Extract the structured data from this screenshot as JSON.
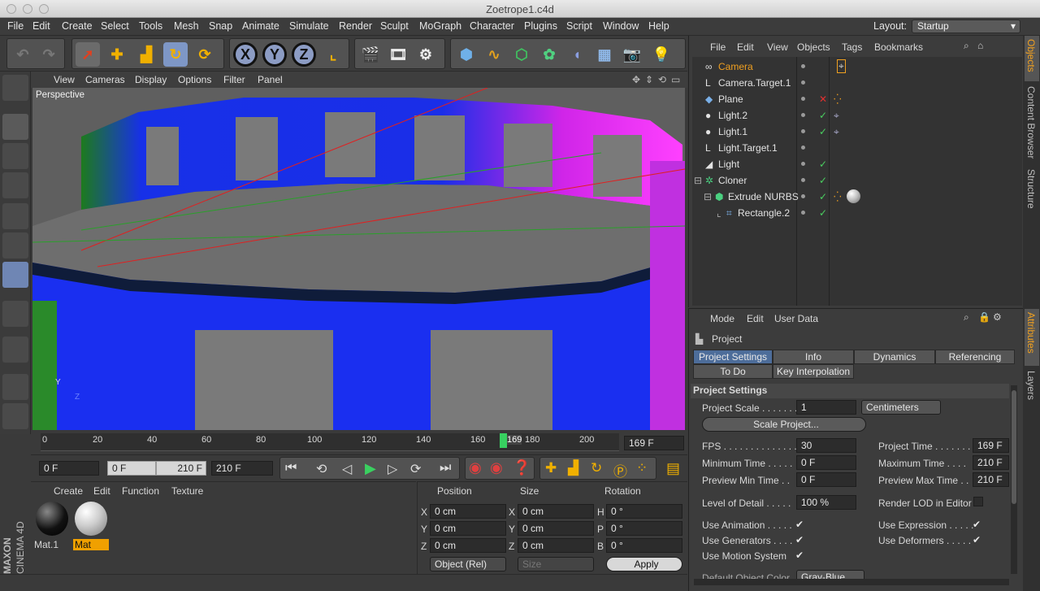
{
  "window": {
    "title": "Zoetrope1.c4d"
  },
  "menu": [
    "File",
    "Edit",
    "Create",
    "Select",
    "Tools",
    "Mesh",
    "Snap",
    "Animate",
    "Simulate",
    "Render",
    "Sculpt",
    "MoGraph",
    "Character",
    "Plugins",
    "Script",
    "Window",
    "Help"
  ],
  "layout": {
    "label": "Layout:",
    "value": "Startup"
  },
  "toolbar": {
    "x": "X",
    "y": "Y",
    "z": "Z"
  },
  "viewport": {
    "menu": [
      "View",
      "Cameras",
      "Display",
      "Options",
      "Filter",
      "Panel"
    ],
    "label": "Perspective"
  },
  "timeline": {
    "ticks": [
      "0",
      "20",
      "40",
      "60",
      "80",
      "100",
      "120",
      "140",
      "160",
      "180",
      "200"
    ],
    "current_frame": "169",
    "frame_field": "169 F"
  },
  "playback": {
    "start": "0 F",
    "range_start": "0 F",
    "range_end": "210 F",
    "end": "210 F"
  },
  "materials": {
    "menu": [
      "Create",
      "Edit",
      "Function",
      "Texture"
    ],
    "items": [
      {
        "name": "Mat.1"
      },
      {
        "name": "Mat"
      }
    ]
  },
  "coords": {
    "headers": [
      "Position",
      "Size",
      "Rotation"
    ],
    "rows": [
      {
        "axis": "X",
        "pos": "0 cm",
        "saxis": "X",
        "size": "0 cm",
        "raxis": "H",
        "rot": "0 °"
      },
      {
        "axis": "Y",
        "pos": "0 cm",
        "saxis": "Y",
        "size": "0 cm",
        "raxis": "P",
        "rot": "0 °"
      },
      {
        "axis": "Z",
        "pos": "0 cm",
        "saxis": "Z",
        "size": "0 cm",
        "raxis": "B",
        "rot": "0 °"
      }
    ],
    "mode": "Object (Rel)",
    "size_mode": "Size",
    "apply": "Apply"
  },
  "objects": {
    "menu": [
      "File",
      "Edit",
      "View",
      "Objects",
      "Tags",
      "Bookmarks"
    ],
    "items": [
      "Camera",
      "Camera.Target.1",
      "Plane",
      "Light.2",
      "Light.1",
      "Light.Target.1",
      "Light",
      "Cloner",
      "Extrude NURBS",
      "Rectangle.2"
    ]
  },
  "attributes": {
    "menu": [
      "Mode",
      "Edit",
      "User Data"
    ],
    "object": "Project",
    "tabs_row1": [
      "Project Settings",
      "Info",
      "Dynamics",
      "Referencing"
    ],
    "tabs_row2": [
      "To Do",
      "Key Interpolation"
    ],
    "section": "Project Settings",
    "project_scale_label": "Project Scale . . . . . . .",
    "project_scale_value": "1",
    "project_scale_unit": "Centimeters",
    "scale_button": "Scale Project...",
    "fps_label": "FPS . . . . . . . . . . . . . . .",
    "fps": "30",
    "project_time_label": "Project Time . . . . . . .",
    "project_time": "169 F",
    "min_time_label": "Minimum Time . . . . .",
    "min_time": "0 F",
    "max_time_label": "Maximum Time . . . .",
    "max_time": "210 F",
    "prev_min_label": "Preview Min Time . .",
    "prev_min": "0 F",
    "prev_max_label": "Preview Max Time . .",
    "prev_max": "210 F",
    "lod_label": "Level of Detail . . . . .",
    "lod": "100 %",
    "render_lod_label": "Render LOD in Editor",
    "use_animation": "Use Animation . . . . .",
    "use_expression": "Use Expression . . . . .",
    "use_generators": "Use Generators . . . .",
    "use_deformers": "Use Deformers . . . . .",
    "use_motion": "Use Motion System",
    "default_color_label": "Default Object Color",
    "default_color": "Gray-Blue"
  },
  "side_tabs": {
    "right_top": [
      "Objects",
      "Content Browser",
      "Structure"
    ],
    "right_bottom": [
      "Attributes",
      "Layers"
    ]
  },
  "brand": {
    "maxon": "MAXON",
    "cinema": "CINEMA 4D"
  }
}
